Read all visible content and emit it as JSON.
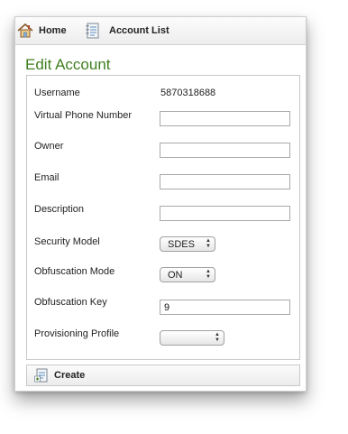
{
  "nav": {
    "home_label": "Home",
    "account_list_label": "Account List"
  },
  "page_title": "Edit Account",
  "form": {
    "username_label": "Username",
    "username_value": "5870318688",
    "virtual_phone_label": "Virtual Phone Number",
    "virtual_phone_value": "",
    "owner_label": "Owner",
    "owner_value": "",
    "email_label": "Email",
    "email_value": "",
    "description_label": "Description",
    "description_value": "",
    "security_model_label": "Security Model",
    "security_model_value": "SDES",
    "obfuscation_mode_label": "Obfuscation Mode",
    "obfuscation_mode_value": "ON",
    "obfuscation_key_label": "Obfuscation Key",
    "obfuscation_key_value": "9",
    "provisioning_profile_label": "Provisioning Profile",
    "provisioning_profile_value": ""
  },
  "footer": {
    "create_label": "Create"
  },
  "icons": {
    "home": "home-icon",
    "account_list": "document-list-icon",
    "create": "create-document-icon"
  },
  "colors": {
    "title": "#3f7f1f"
  }
}
